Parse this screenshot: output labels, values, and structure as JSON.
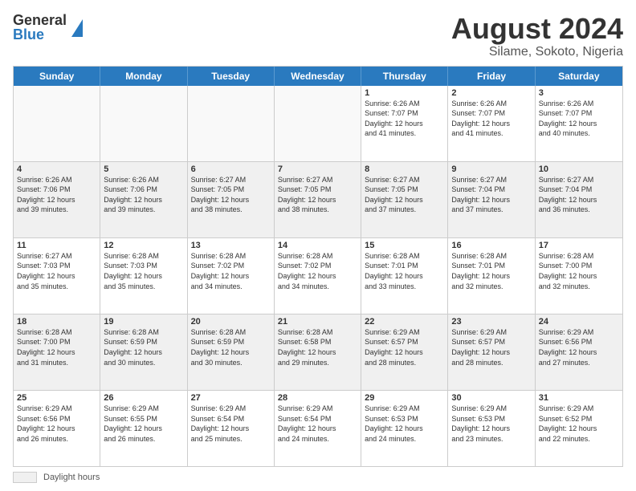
{
  "header": {
    "logo_general": "General",
    "logo_blue": "Blue",
    "title": "August 2024",
    "location": "Silame, Sokoto, Nigeria"
  },
  "footer": {
    "daylight_label": "Daylight hours"
  },
  "days_of_week": [
    "Sunday",
    "Monday",
    "Tuesday",
    "Wednesday",
    "Thursday",
    "Friday",
    "Saturday"
  ],
  "weeks": [
    [
      {
        "day": "",
        "info": ""
      },
      {
        "day": "",
        "info": ""
      },
      {
        "day": "",
        "info": ""
      },
      {
        "day": "",
        "info": ""
      },
      {
        "day": "1",
        "info": "Sunrise: 6:26 AM\nSunset: 7:07 PM\nDaylight: 12 hours\nand 41 minutes."
      },
      {
        "day": "2",
        "info": "Sunrise: 6:26 AM\nSunset: 7:07 PM\nDaylight: 12 hours\nand 41 minutes."
      },
      {
        "day": "3",
        "info": "Sunrise: 6:26 AM\nSunset: 7:07 PM\nDaylight: 12 hours\nand 40 minutes."
      }
    ],
    [
      {
        "day": "4",
        "info": "Sunrise: 6:26 AM\nSunset: 7:06 PM\nDaylight: 12 hours\nand 39 minutes."
      },
      {
        "day": "5",
        "info": "Sunrise: 6:26 AM\nSunset: 7:06 PM\nDaylight: 12 hours\nand 39 minutes."
      },
      {
        "day": "6",
        "info": "Sunrise: 6:27 AM\nSunset: 7:05 PM\nDaylight: 12 hours\nand 38 minutes."
      },
      {
        "day": "7",
        "info": "Sunrise: 6:27 AM\nSunset: 7:05 PM\nDaylight: 12 hours\nand 38 minutes."
      },
      {
        "day": "8",
        "info": "Sunrise: 6:27 AM\nSunset: 7:05 PM\nDaylight: 12 hours\nand 37 minutes."
      },
      {
        "day": "9",
        "info": "Sunrise: 6:27 AM\nSunset: 7:04 PM\nDaylight: 12 hours\nand 37 minutes."
      },
      {
        "day": "10",
        "info": "Sunrise: 6:27 AM\nSunset: 7:04 PM\nDaylight: 12 hours\nand 36 minutes."
      }
    ],
    [
      {
        "day": "11",
        "info": "Sunrise: 6:27 AM\nSunset: 7:03 PM\nDaylight: 12 hours\nand 35 minutes."
      },
      {
        "day": "12",
        "info": "Sunrise: 6:28 AM\nSunset: 7:03 PM\nDaylight: 12 hours\nand 35 minutes."
      },
      {
        "day": "13",
        "info": "Sunrise: 6:28 AM\nSunset: 7:02 PM\nDaylight: 12 hours\nand 34 minutes."
      },
      {
        "day": "14",
        "info": "Sunrise: 6:28 AM\nSunset: 7:02 PM\nDaylight: 12 hours\nand 34 minutes."
      },
      {
        "day": "15",
        "info": "Sunrise: 6:28 AM\nSunset: 7:01 PM\nDaylight: 12 hours\nand 33 minutes."
      },
      {
        "day": "16",
        "info": "Sunrise: 6:28 AM\nSunset: 7:01 PM\nDaylight: 12 hours\nand 32 minutes."
      },
      {
        "day": "17",
        "info": "Sunrise: 6:28 AM\nSunset: 7:00 PM\nDaylight: 12 hours\nand 32 minutes."
      }
    ],
    [
      {
        "day": "18",
        "info": "Sunrise: 6:28 AM\nSunset: 7:00 PM\nDaylight: 12 hours\nand 31 minutes."
      },
      {
        "day": "19",
        "info": "Sunrise: 6:28 AM\nSunset: 6:59 PM\nDaylight: 12 hours\nand 30 minutes."
      },
      {
        "day": "20",
        "info": "Sunrise: 6:28 AM\nSunset: 6:59 PM\nDaylight: 12 hours\nand 30 minutes."
      },
      {
        "day": "21",
        "info": "Sunrise: 6:28 AM\nSunset: 6:58 PM\nDaylight: 12 hours\nand 29 minutes."
      },
      {
        "day": "22",
        "info": "Sunrise: 6:29 AM\nSunset: 6:57 PM\nDaylight: 12 hours\nand 28 minutes."
      },
      {
        "day": "23",
        "info": "Sunrise: 6:29 AM\nSunset: 6:57 PM\nDaylight: 12 hours\nand 28 minutes."
      },
      {
        "day": "24",
        "info": "Sunrise: 6:29 AM\nSunset: 6:56 PM\nDaylight: 12 hours\nand 27 minutes."
      }
    ],
    [
      {
        "day": "25",
        "info": "Sunrise: 6:29 AM\nSunset: 6:56 PM\nDaylight: 12 hours\nand 26 minutes."
      },
      {
        "day": "26",
        "info": "Sunrise: 6:29 AM\nSunset: 6:55 PM\nDaylight: 12 hours\nand 26 minutes."
      },
      {
        "day": "27",
        "info": "Sunrise: 6:29 AM\nSunset: 6:54 PM\nDaylight: 12 hours\nand 25 minutes."
      },
      {
        "day": "28",
        "info": "Sunrise: 6:29 AM\nSunset: 6:54 PM\nDaylight: 12 hours\nand 24 minutes."
      },
      {
        "day": "29",
        "info": "Sunrise: 6:29 AM\nSunset: 6:53 PM\nDaylight: 12 hours\nand 24 minutes."
      },
      {
        "day": "30",
        "info": "Sunrise: 6:29 AM\nSunset: 6:53 PM\nDaylight: 12 hours\nand 23 minutes."
      },
      {
        "day": "31",
        "info": "Sunrise: 6:29 AM\nSunset: 6:52 PM\nDaylight: 12 hours\nand 22 minutes."
      }
    ]
  ]
}
